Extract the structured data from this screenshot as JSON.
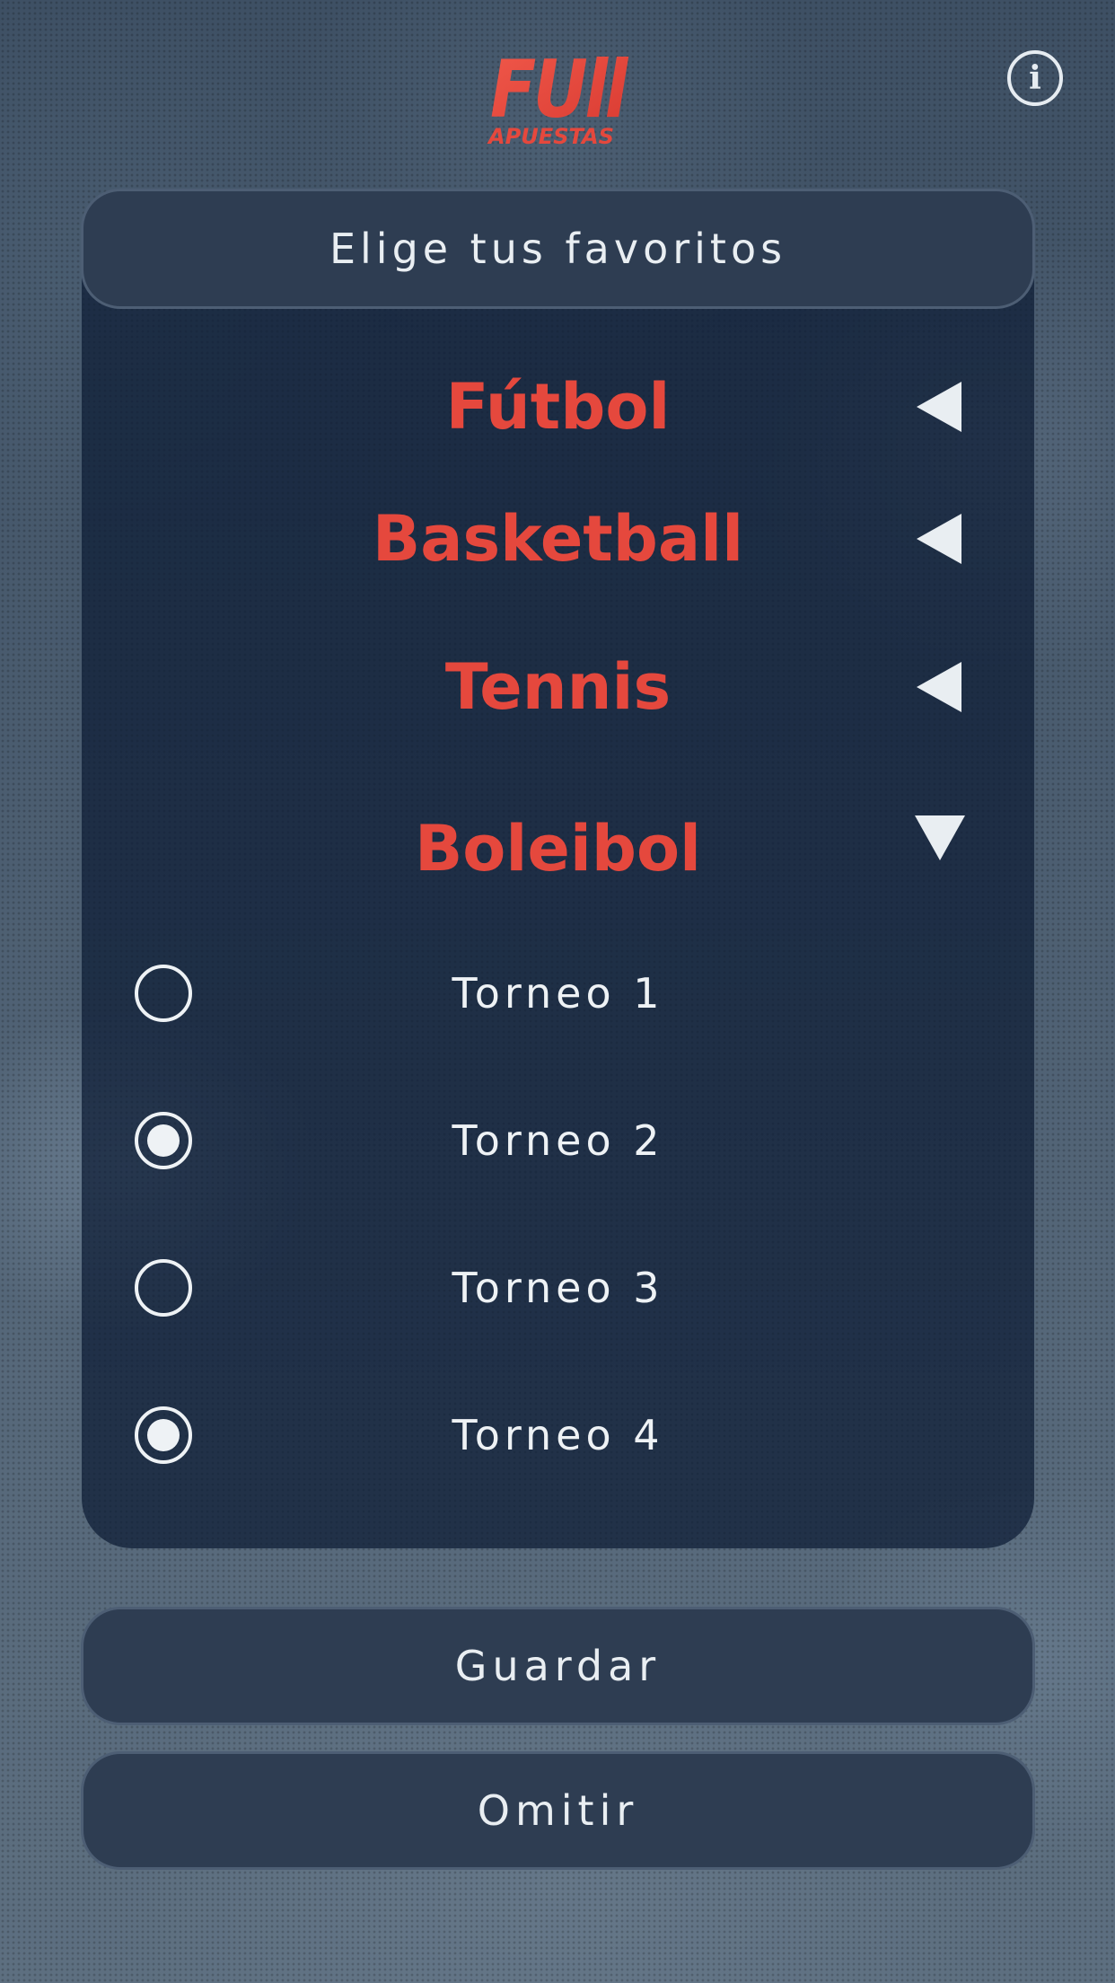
{
  "header": {
    "logo_text_main": "FUll",
    "logo_text_sub": "APUESTAS",
    "info_icon": "info-icon"
  },
  "card": {
    "title": "Elige tus favoritos"
  },
  "sports": [
    {
      "label": "Fútbol",
      "state": "collapsed",
      "icon": "triangle-left-icon"
    },
    {
      "label": "Basketball",
      "state": "collapsed",
      "icon": "triangle-left-icon"
    },
    {
      "label": "Tennis",
      "state": "collapsed",
      "icon": "triangle-left-icon"
    },
    {
      "label": "Boleibol",
      "state": "expanded",
      "icon": "triangle-down-icon"
    }
  ],
  "tournaments": [
    {
      "label": "Torneo 1",
      "selected": false
    },
    {
      "label": "Torneo 2",
      "selected": true
    },
    {
      "label": "Torneo 3",
      "selected": false
    },
    {
      "label": "Torneo 4",
      "selected": true
    }
  ],
  "actions": {
    "save_label": "Guardar",
    "skip_label": "Omitir"
  },
  "colors": {
    "accent": "#e5483d",
    "text_light": "#e9eef2",
    "panel": "#2e3d52",
    "card": "#0c1c34"
  }
}
